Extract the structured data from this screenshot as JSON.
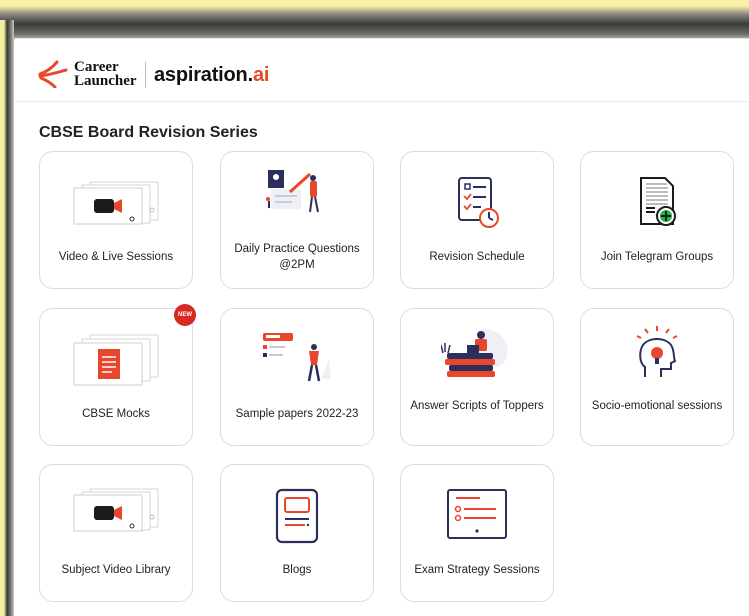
{
  "brand": {
    "career_launcher_line1": "Career",
    "career_launcher_line2": "Launcher",
    "aspiration_main": "aspiration.",
    "aspiration_suffix": "ai"
  },
  "section": {
    "title": "CBSE Board Revision Series"
  },
  "cards": [
    {
      "label": "Video & Live Sessions"
    },
    {
      "label": "Daily Practice Questions @2PM"
    },
    {
      "label": "Revision Schedule"
    },
    {
      "label": "Join Telegram Groups"
    },
    {
      "label": "CBSE Mocks",
      "badge": "NEW"
    },
    {
      "label": "Sample papers 2022-23"
    },
    {
      "label": "Answer Scripts of Toppers"
    },
    {
      "label": "Socio-emotional sessions"
    },
    {
      "label": "Subject Video Library"
    },
    {
      "label": "Blogs"
    },
    {
      "label": "Exam Strategy Sessions"
    }
  ],
  "colors": {
    "accent": "#e8472b",
    "navy": "#2b2f5c",
    "badge": "#d82a20"
  }
}
